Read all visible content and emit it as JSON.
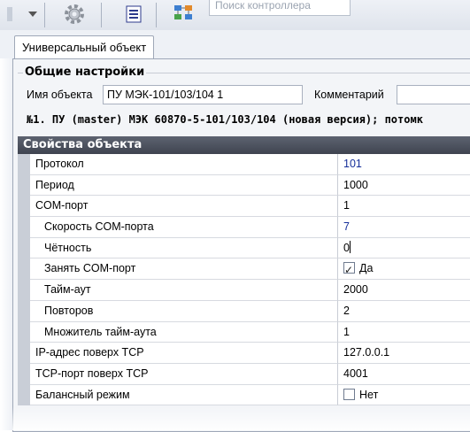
{
  "toolbar": {
    "search_placeholder": "Поиск контроллера",
    "icons": [
      "dropdown-arrow-icon",
      "gear-icon",
      "document-list-icon",
      "network-icon"
    ]
  },
  "tab": {
    "label": "Универсальный объект"
  },
  "general": {
    "title": "Общие настройки",
    "object_name_label": "Имя объекта",
    "object_name_value": "ПУ МЭК-101/103/104 1",
    "comment_label": "Комментарий",
    "comment_value": "",
    "description": "№1. ПУ (master) МЭК 60870-5-101/103/104 (новая версия); потомк"
  },
  "properties": {
    "title": "Свойства объекта",
    "rows": [
      {
        "name": "Протокол",
        "value": "101"
      },
      {
        "name": "Период",
        "value": "1000"
      },
      {
        "name": "COM-порт",
        "value": "1"
      },
      {
        "name": "Скорость COM-порта",
        "value": "7"
      },
      {
        "name": "Чётность",
        "value": "0"
      },
      {
        "name": "Занять COM-порт",
        "value": "Да"
      },
      {
        "name": "Тайм-аут",
        "value": "2000"
      },
      {
        "name": "Повторов",
        "value": "2"
      },
      {
        "name": "Множитель тайм-аута",
        "value": "1"
      },
      {
        "name": "IP-адрес поверх TCP",
        "value": "127.0.0.1"
      },
      {
        "name": "TCP-порт поверх TCP",
        "value": "4001"
      },
      {
        "name": "Баланcный режим",
        "value": "Нет"
      }
    ]
  },
  "colors": {
    "header_bg": "#4a505c",
    "value_blue": "#17309a"
  }
}
